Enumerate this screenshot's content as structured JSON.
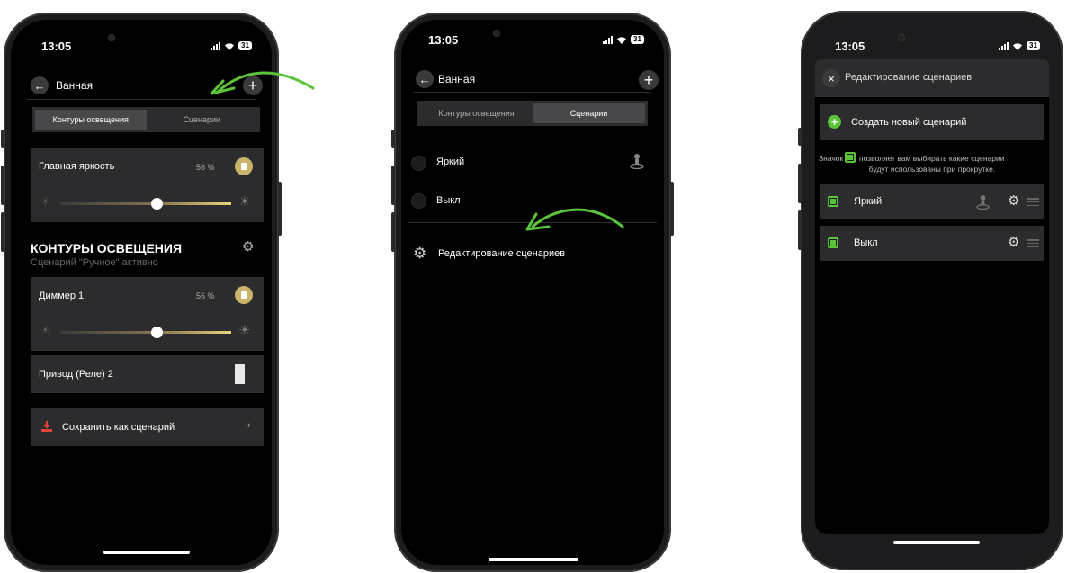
{
  "phone1": {
    "time": "13:05",
    "battery": "31",
    "title": "Ванная",
    "tabs": [
      "Контуры освещения",
      "Сценарии"
    ],
    "main_brightness": {
      "label": "Главная яркость",
      "value": "56 %",
      "level": 0.56
    },
    "section_title": "КОНТУРЫ ОСВЕЩЕНИЯ",
    "section_subtitle": "Сценарий \"Ручное\" активно",
    "dimmer": {
      "label": "Диммер 1",
      "value": "56 %",
      "level": 0.56
    },
    "relay": {
      "label": "Привод (Реле) 2"
    },
    "save_label": "Сохранить как сценарий"
  },
  "phone2": {
    "time": "13:05",
    "battery": "31",
    "title": "Ванная",
    "tabs": [
      "Контуры освещения",
      "Сценарии"
    ],
    "scenarios": [
      "Яркий",
      "Выкл"
    ],
    "edit_label": "Редактирование сценариев"
  },
  "phone3": {
    "time": "13:05",
    "battery": "31",
    "title": "Редактирование сценариев",
    "create_label": "Создать новый сценарий",
    "note_prefix": "Значок",
    "note_line1": "позволяет вам выбирать какие сценарии",
    "note_line2": "будут использованы при прокрутке.",
    "scenarios": [
      "Яркий",
      "Выкл"
    ]
  },
  "colors": {
    "accent_green": "#5cc43a",
    "gold": "#c9b46a",
    "save_icon": "#e0453a"
  },
  "icons": [
    "back-arrow-icon",
    "plus-icon",
    "bulb-icon",
    "sun-icon",
    "gear-icon",
    "person-icon",
    "save-icon",
    "chevron-right-icon",
    "close-icon",
    "drag-handle-icon"
  ]
}
